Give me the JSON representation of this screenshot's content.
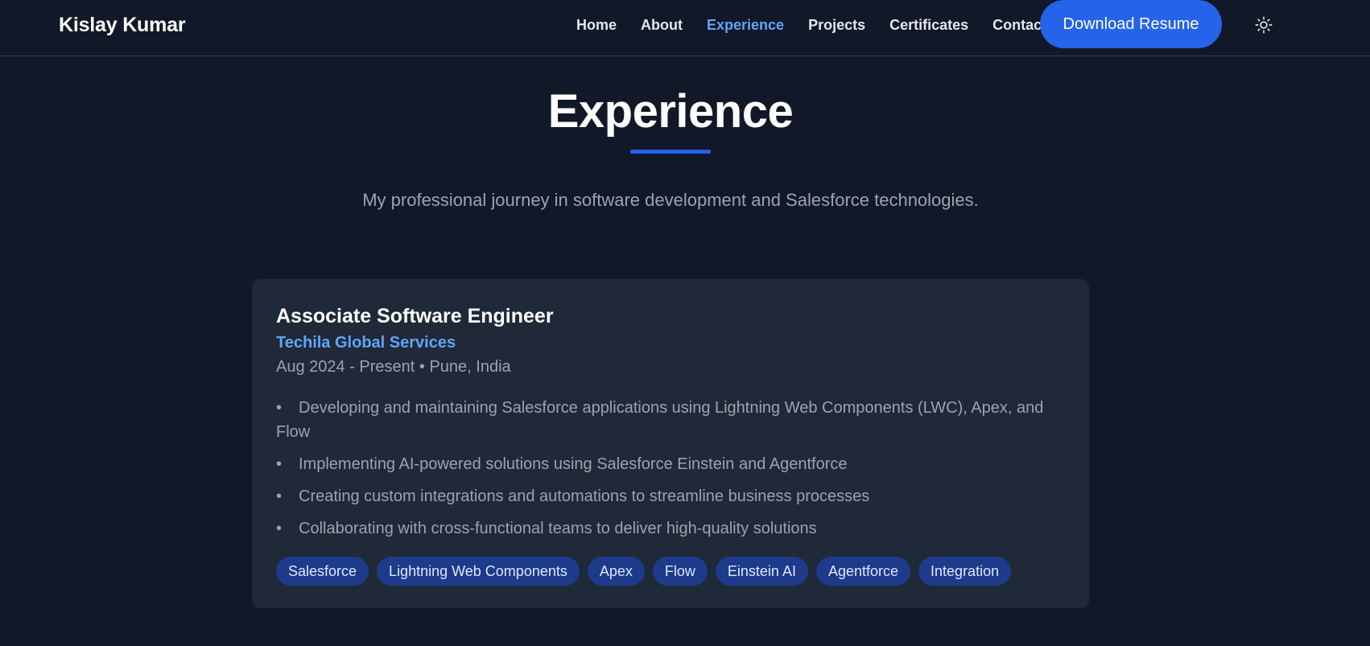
{
  "header": {
    "brand": "Kislay Kumar",
    "nav": [
      {
        "label": "Home"
      },
      {
        "label": "About"
      },
      {
        "label": "Experience"
      },
      {
        "label": "Projects"
      },
      {
        "label": "Certificates"
      },
      {
        "label": "Contact"
      }
    ],
    "active_nav": "Experience",
    "resume_button": "Download Resume",
    "theme_icon": "sun-icon"
  },
  "section": {
    "title": "Experience",
    "subtitle": "My professional journey in software development and Salesforce technologies."
  },
  "experience": [
    {
      "title": "Associate Software Engineer",
      "company": "Techila Global Services",
      "meta": "Aug 2024 - Present • Pune, India",
      "bullets": [
        "Developing and maintaining Salesforce applications using Lightning Web Components (LWC), Apex, and Flow",
        "Implementing AI-powered solutions using Salesforce Einstein and Agentforce",
        "Creating custom integrations and automations to streamline business processes",
        "Collaborating with cross-functional teams to deliver high-quality solutions"
      ],
      "tags": [
        "Salesforce",
        "Lightning Web Components",
        "Apex",
        "Flow",
        "Einstein AI",
        "Agentforce",
        "Integration"
      ]
    }
  ],
  "colors": {
    "background": "#111827",
    "card": "#1f2937",
    "accent": "#2563eb",
    "link_active": "#60a5fa",
    "tag_bg": "#1e3a8a"
  }
}
